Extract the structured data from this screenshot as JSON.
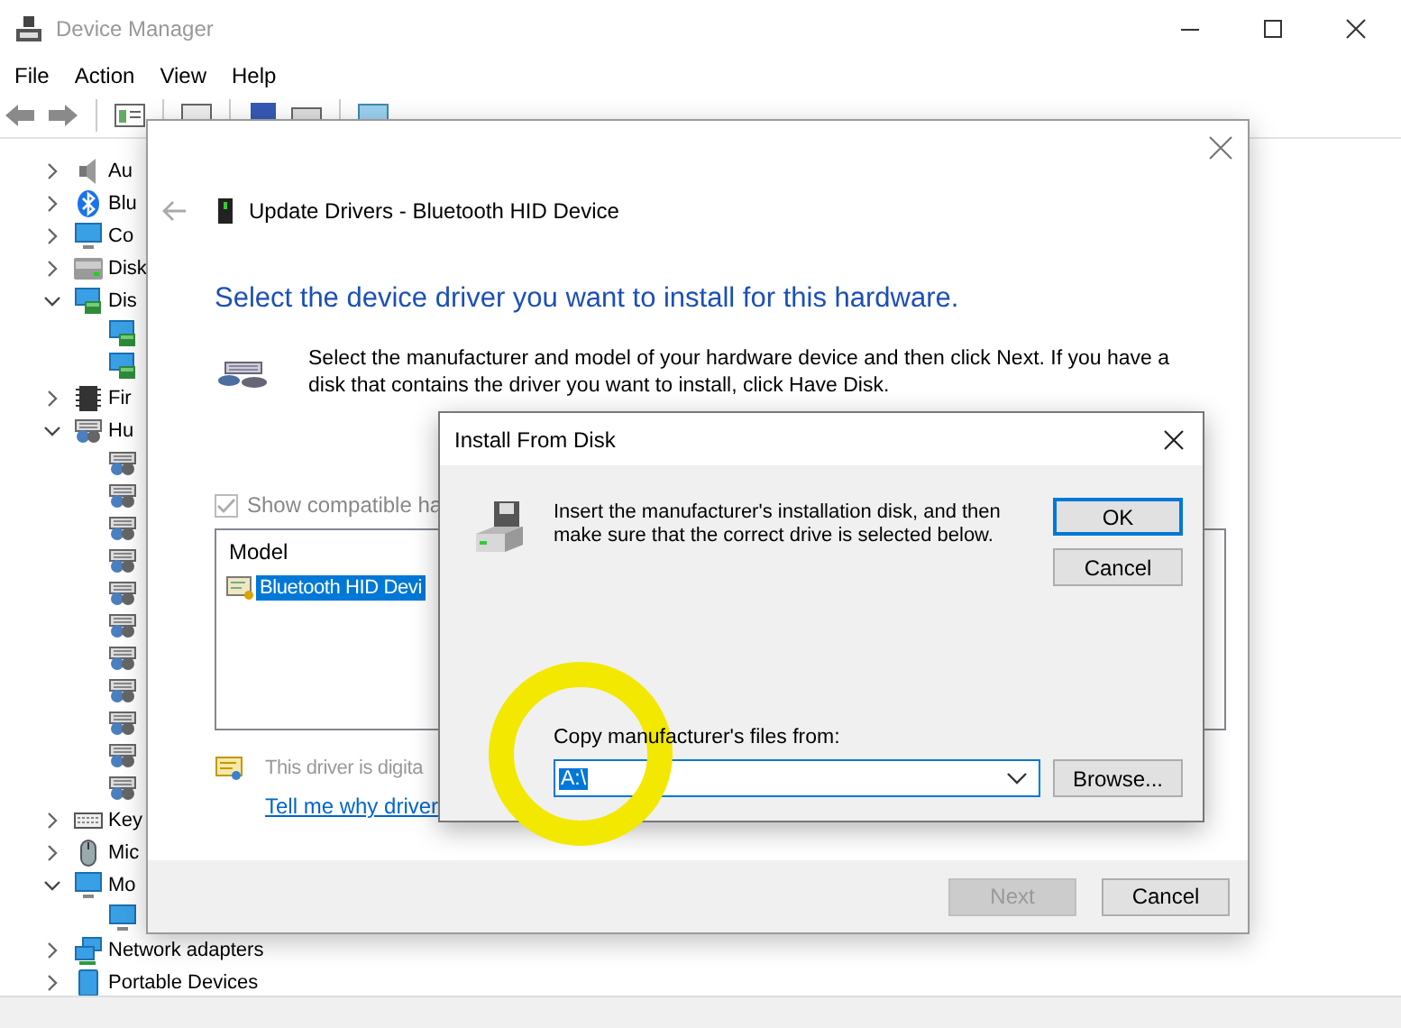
{
  "window": {
    "title": "Device Manager"
  },
  "menu": [
    "File",
    "Action",
    "View",
    "Help"
  ],
  "tree": [
    {
      "label": "Au",
      "kind": "audio",
      "expanded": false
    },
    {
      "label": "Blu",
      "kind": "bluetooth",
      "expanded": false
    },
    {
      "label": "Co",
      "kind": "computer",
      "expanded": false
    },
    {
      "label": "Disk",
      "kind": "disk",
      "expanded": false
    },
    {
      "label": "Dis",
      "kind": "display",
      "expanded": true,
      "children": [
        {
          "kind": "display"
        },
        {
          "kind": "display"
        }
      ]
    },
    {
      "label": "Fir",
      "kind": "firmware",
      "expanded": false
    },
    {
      "label": "Hu",
      "kind": "hid",
      "expanded": true,
      "children": [
        {
          "kind": "hid"
        },
        {
          "kind": "hid"
        },
        {
          "kind": "hid"
        },
        {
          "kind": "hid"
        },
        {
          "kind": "hid"
        },
        {
          "kind": "hid"
        },
        {
          "kind": "hid"
        },
        {
          "kind": "hid"
        },
        {
          "kind": "hid"
        },
        {
          "kind": "hid"
        },
        {
          "kind": "hid"
        }
      ]
    },
    {
      "label": "Key",
      "kind": "keyboard",
      "expanded": false
    },
    {
      "label": "Mic",
      "kind": "mouse",
      "expanded": false
    },
    {
      "label": "Mo",
      "kind": "monitor",
      "expanded": true,
      "children": [
        {
          "kind": "monitor"
        }
      ]
    },
    {
      "label": "Network adapters",
      "kind": "network",
      "expanded": false
    },
    {
      "label": "Portable Devices",
      "kind": "portable",
      "expanded": false
    }
  ],
  "update_dialog": {
    "title": "Update Drivers - Bluetooth HID Device",
    "heading": "Select the device driver you want to install for this hardware.",
    "description": "Select the manufacturer and model of your hardware device and then click Next. If you have a disk that contains the driver you want to install, click Have Disk.",
    "show_compatible": {
      "label": "Show compatible ha",
      "checked": true,
      "disabled": true
    },
    "model_list": {
      "column": "Model",
      "rows": [
        {
          "label": "Bluetooth HID Devi",
          "selected": true
        }
      ]
    },
    "signed_note": "This driver is digita",
    "link": "Tell me why driver",
    "buttons": [
      {
        "label": "Next",
        "disabled": true
      },
      {
        "label": "Cancel",
        "disabled": false
      }
    ]
  },
  "install_dialog": {
    "title": "Install From Disk",
    "message": "Insert the manufacturer's installation disk, and then make sure that the correct drive is selected below.",
    "buttons": [
      {
        "label": "OK",
        "default": true
      },
      {
        "label": "Cancel",
        "default": false
      }
    ],
    "copy_label": "Copy manufacturer's files from:",
    "path": {
      "value": "A:\\",
      "selected": true
    },
    "browse": "Browse..."
  }
}
